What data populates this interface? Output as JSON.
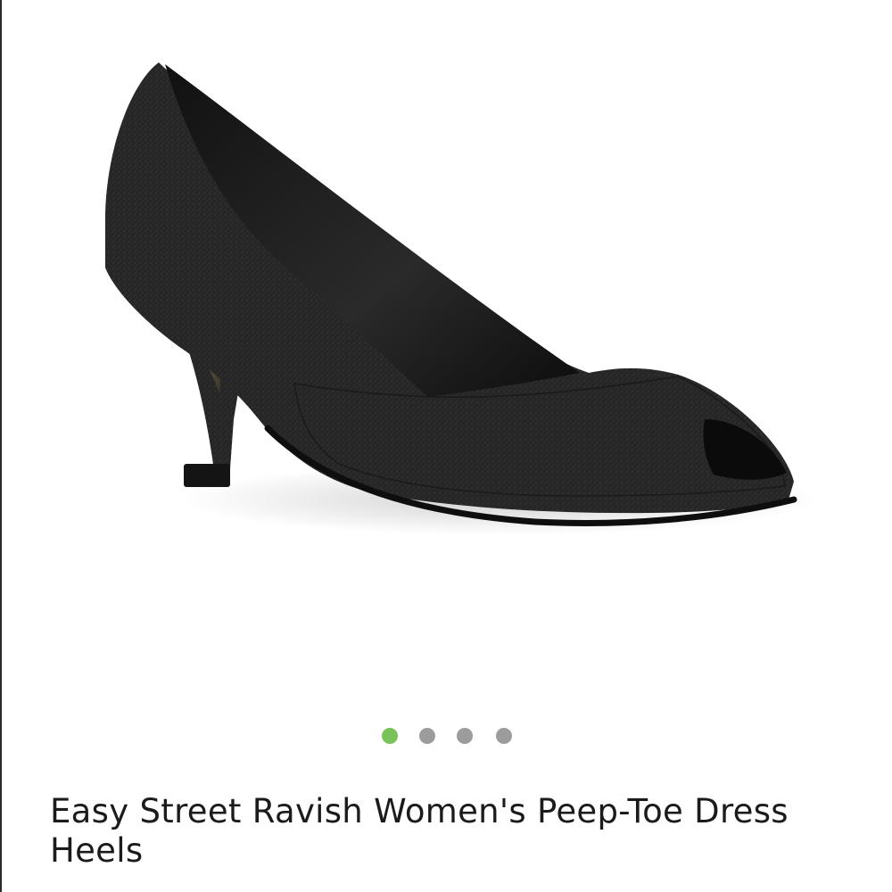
{
  "product": {
    "title": "Easy Street Ravish Women's Peep-Toe Dress Heels",
    "image_alt": "black glitter peep-toe pump"
  },
  "carousel": {
    "total_images": 4,
    "active_index": 0,
    "active_color": "#79c35a",
    "inactive_color": "#9c9c9c"
  }
}
